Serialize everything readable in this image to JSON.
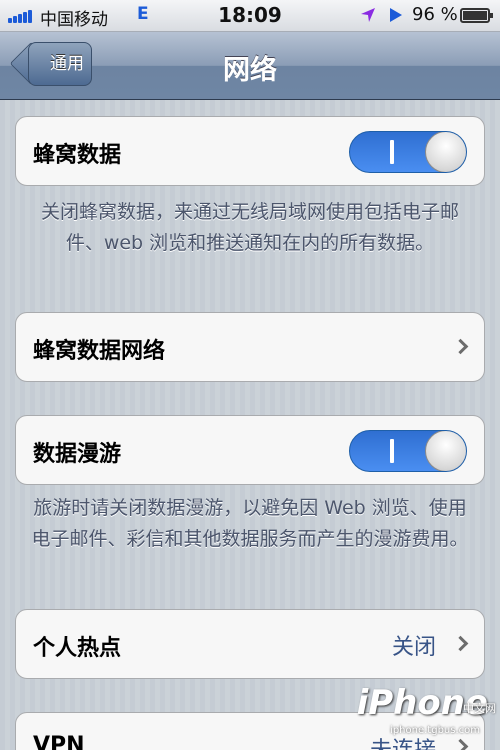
{
  "status_bar": {
    "carrier": "中国移动",
    "network": "E",
    "time": "18:09",
    "battery_percent": "96 %",
    "battery_level": 0.96,
    "signal_bars": 5,
    "icons": [
      "location-arrow-icon",
      "play-icon",
      "battery-icon"
    ]
  },
  "nav": {
    "back_label": "通用",
    "title": "网络"
  },
  "cells": {
    "cellular_data": {
      "label": "蜂窝数据",
      "toggle": "I",
      "on": true
    },
    "cellular_network": {
      "label": "蜂窝数据网络"
    },
    "data_roaming": {
      "label": "数据漫游",
      "toggle": "I",
      "on": true
    },
    "hotspot": {
      "label": "个人热点",
      "value": "关闭"
    },
    "vpn": {
      "label": "VPN",
      "value": "未连接"
    }
  },
  "footers": {
    "cellular_data": "关闭蜂窝数据，来通过无线局域网使用包括电子邮件、web 浏览和推送通知在内的所有数据。",
    "data_roaming": "旅游时请关闭数据漫游，以避免因 Web 浏览、使用电子邮件、彩信和其他数据服务而产生的漫游费用。"
  },
  "watermark": {
    "brand": "iPhone",
    "site": "iphone.tgbus.com",
    "tag": "中文网"
  },
  "colors": {
    "accent_blue": "#2f6fd1",
    "value_blue": "#385487",
    "navbar": "#6d84a2"
  }
}
